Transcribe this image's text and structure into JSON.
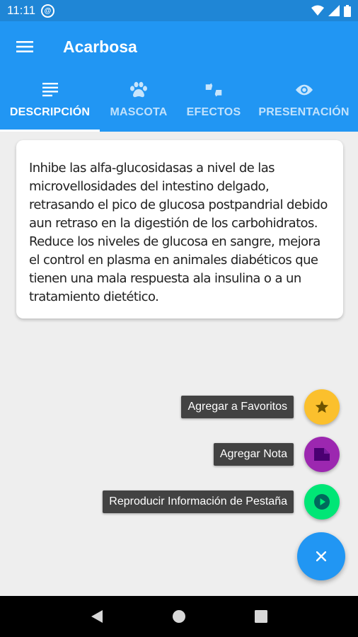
{
  "status_bar": {
    "time": "11:11",
    "sync_glyph": "@"
  },
  "app_bar": {
    "menu_icon": "hamburger-menu-icon",
    "title": "Acarbosa"
  },
  "tabs": [
    {
      "label": "DESCRIPCIÓN",
      "icon": "notes-icon",
      "active": true
    },
    {
      "label": "MASCOTA",
      "icon": "paw-icon",
      "active": false
    },
    {
      "label": "EFECTOS",
      "icon": "thumbs-up-down-icon",
      "active": false
    },
    {
      "label": "PRESENTACIÓN",
      "icon": "eye-icon",
      "active": false
    }
  ],
  "description": {
    "text": "Inhibe las alfa-glucosidasas a nivel de las microvellosidades del intestino delgado, retrasando el pico de glucosa postpandrial debido aun retraso en la digestión de los carbohidratos. Reduce los niveles de glucosa en sangre, mejora el control en plasma en animales diabéticos que tienen una mala respuesta ala insulina o a un tratamiento dietético."
  },
  "speed_dial": {
    "actions": [
      {
        "label": "Agregar a Favoritos",
        "icon": "star-icon",
        "color": "#fbc02d"
      },
      {
        "label": "Agregar Nota",
        "icon": "note-icon",
        "color": "#9c27b0"
      },
      {
        "label": "Reproducir Información de Pestaña",
        "icon": "play-icon",
        "color": "#00e676"
      }
    ],
    "main_icon": "close-icon",
    "main_color": "#2196f3"
  },
  "colors": {
    "primary": "#2196f3",
    "primary_dark": "#1f86d6",
    "background": "#eeeeee"
  }
}
